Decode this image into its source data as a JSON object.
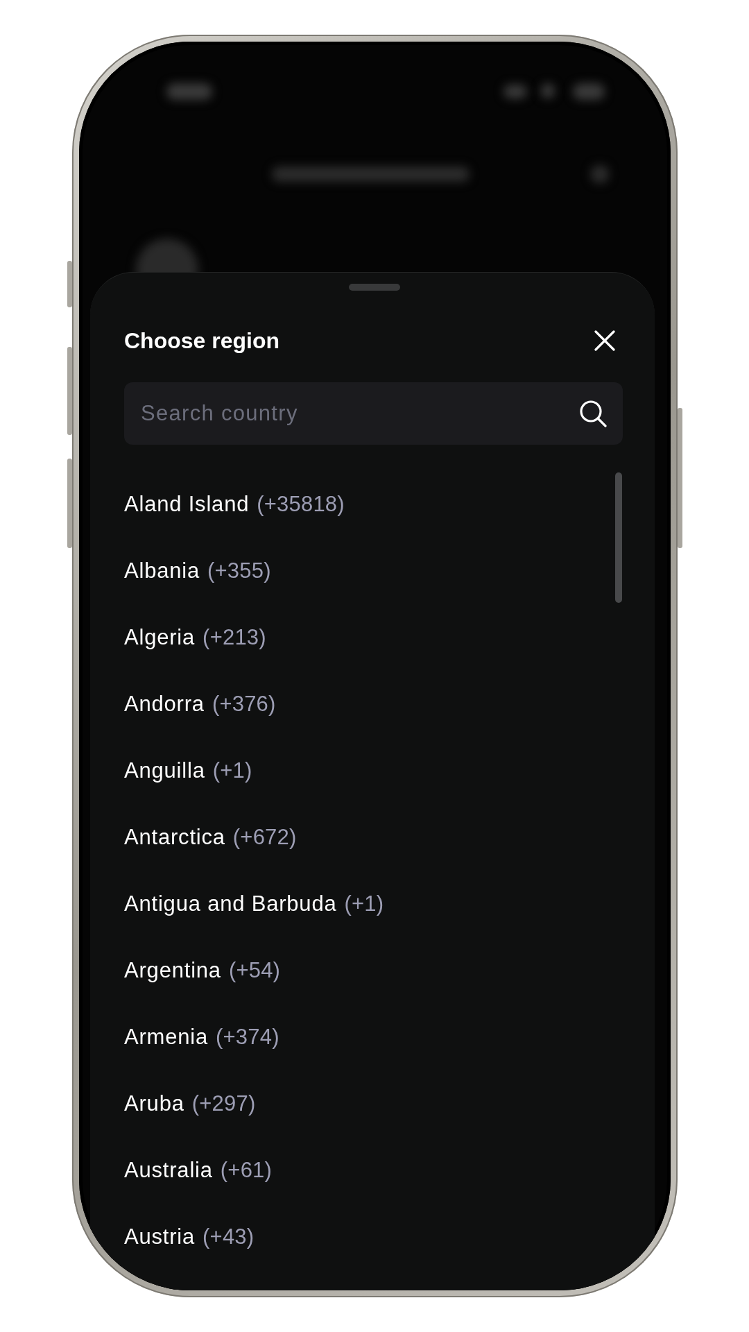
{
  "sheet": {
    "title": "Choose region",
    "search": {
      "placeholder": "Search country"
    },
    "countries": [
      {
        "name": "Aland Island",
        "dial_code": "(+35818)"
      },
      {
        "name": "Albania",
        "dial_code": "(+355)"
      },
      {
        "name": "Algeria",
        "dial_code": "(+213)"
      },
      {
        "name": "Andorra",
        "dial_code": "(+376)"
      },
      {
        "name": "Anguilla",
        "dial_code": "(+1)"
      },
      {
        "name": "Antarctica",
        "dial_code": "(+672)"
      },
      {
        "name": "Antigua and Barbuda",
        "dial_code": "(+1)"
      },
      {
        "name": "Argentina",
        "dial_code": "(+54)"
      },
      {
        "name": "Armenia",
        "dial_code": "(+374)"
      },
      {
        "name": "Aruba",
        "dial_code": "(+297)"
      },
      {
        "name": "Australia",
        "dial_code": "(+61)"
      },
      {
        "name": "Austria",
        "dial_code": "(+43)"
      }
    ]
  }
}
